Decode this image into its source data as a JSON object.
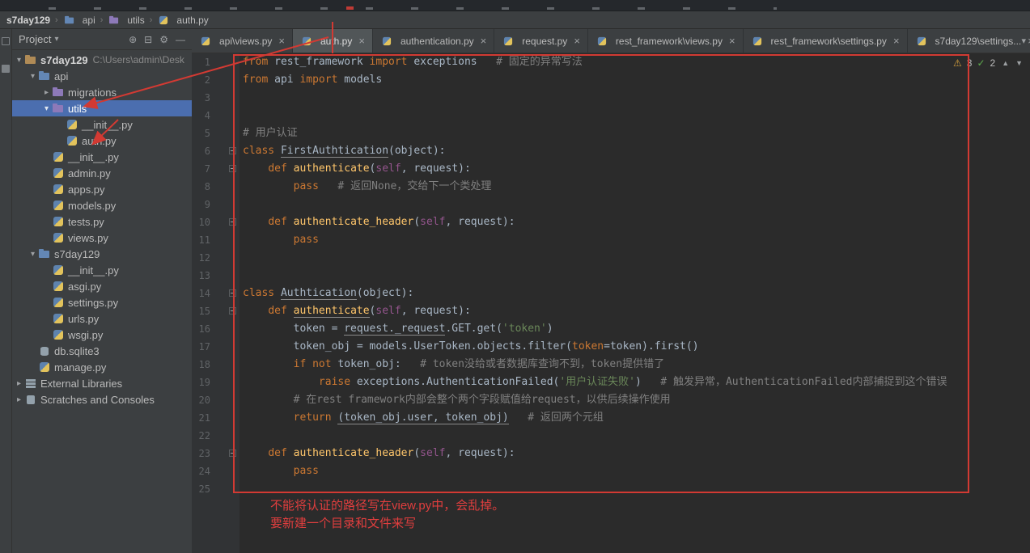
{
  "theme": {
    "editor_bg": "#2b2b2b",
    "panel_bg": "#3c3f41",
    "selection_blue": "#4b6eaf",
    "keyword_orange": "#cc7832",
    "string_green": "#6a8759",
    "comment_gray": "#808080",
    "function_yellow": "#ffc66b",
    "annotation_red": "#e03e3e",
    "warning_yellow": "#d6a13d",
    "ok_green": "#5fad4e"
  },
  "breadcrumbs": {
    "items": [
      {
        "label": "s7day129"
      },
      {
        "label": "api",
        "icon": "folder f-blue"
      },
      {
        "label": "utils",
        "icon": "folder f-purple"
      },
      {
        "label": "auth.py",
        "icon": "py"
      }
    ]
  },
  "project": {
    "header_label": "Project",
    "header_icons": {
      "locate": "⊕",
      "collapse_all": "⊟",
      "settings": "⚙",
      "hide": "—"
    },
    "items": [
      {
        "label": "s7day129",
        "sub": "C:\\Users\\admin\\Desk",
        "icon": "folder f-root",
        "indent": 1,
        "chev": "down",
        "bold": true
      },
      {
        "label": "api",
        "icon": "folder f-blue",
        "indent": 2,
        "chev": "down"
      },
      {
        "label": "migrations",
        "icon": "folder f-purple",
        "indent": 3,
        "chev": "right"
      },
      {
        "label": "utils",
        "icon": "folder f-purple",
        "indent": 3,
        "chev": "down",
        "selected": true
      },
      {
        "label": "__init__.py",
        "icon": "py",
        "indent": 4
      },
      {
        "label": "auth.py",
        "icon": "py",
        "indent": 4
      },
      {
        "label": "__init__.py",
        "icon": "py",
        "indent": 3
      },
      {
        "label": "admin.py",
        "icon": "py",
        "indent": 3
      },
      {
        "label": "apps.py",
        "icon": "py",
        "indent": 3
      },
      {
        "label": "models.py",
        "icon": "py",
        "indent": 3
      },
      {
        "label": "tests.py",
        "icon": "py",
        "indent": 3
      },
      {
        "label": "views.py",
        "icon": "py",
        "indent": 3
      },
      {
        "label": "s7day129",
        "icon": "folder f-blue",
        "indent": 2,
        "chev": "down"
      },
      {
        "label": "__init__.py",
        "icon": "py",
        "indent": 3
      },
      {
        "label": "asgi.py",
        "icon": "py",
        "indent": 3
      },
      {
        "label": "settings.py",
        "icon": "py",
        "indent": 3
      },
      {
        "label": "urls.py",
        "icon": "py",
        "indent": 3
      },
      {
        "label": "wsgi.py",
        "icon": "py",
        "indent": 3
      },
      {
        "label": "db.sqlite3",
        "icon": "db",
        "indent": 2
      },
      {
        "label": "manage.py",
        "icon": "py",
        "indent": 2
      },
      {
        "label": "External Libraries",
        "icon": "libs",
        "indent": 1,
        "chev": "right"
      },
      {
        "label": "Scratches and Consoles",
        "icon": "scratch",
        "indent": 1,
        "chev": "right"
      }
    ]
  },
  "tabs": {
    "items": [
      {
        "label": "api\\views.py"
      },
      {
        "label": "auth.py",
        "active": true
      },
      {
        "label": "authentication.py"
      },
      {
        "label": "request.py"
      },
      {
        "label": "rest_framework\\views.py"
      },
      {
        "label": "rest_framework\\settings.py"
      },
      {
        "label": "s7day129\\settings..."
      }
    ]
  },
  "inspection": {
    "warnings": "3",
    "ok": "2"
  },
  "editor": {
    "folds": [
      6,
      7,
      10,
      14,
      15,
      23
    ],
    "lines": [
      {
        "n": 1,
        "s": [
          [
            "kw",
            "from"
          ],
          [
            "",
            " rest_framework "
          ],
          [
            "kw",
            "import"
          ],
          [
            "",
            " exceptions"
          ],
          [
            "cm",
            "   # 固定的异常写法"
          ]
        ]
      },
      {
        "n": 2,
        "s": [
          [
            "kw",
            "from"
          ],
          [
            "",
            " api "
          ],
          [
            "kw",
            "import"
          ],
          [
            "",
            " models"
          ]
        ]
      },
      {
        "n": 3,
        "s": []
      },
      {
        "n": 4,
        "s": []
      },
      {
        "n": 5,
        "s": [
          [
            "cm",
            "# 用户认证"
          ]
        ]
      },
      {
        "n": 6,
        "s": [
          [
            "kw",
            "class"
          ],
          [
            "",
            " "
          ],
          [
            "u",
            "FirstAuthtication"
          ],
          [
            "",
            "(object):"
          ]
        ]
      },
      {
        "n": 7,
        "s": [
          [
            "",
            "    "
          ],
          [
            "kw",
            "def"
          ],
          [
            "",
            " "
          ],
          [
            "fn",
            "authenticate"
          ],
          [
            "",
            "("
          ],
          [
            "slf",
            "self"
          ],
          [
            "",
            ", request):"
          ]
        ]
      },
      {
        "n": 8,
        "s": [
          [
            "",
            "        "
          ],
          [
            "kw",
            "pass"
          ],
          [
            "cm",
            "   # 返回None，交给下一个类处理"
          ]
        ]
      },
      {
        "n": 9,
        "s": []
      },
      {
        "n": 10,
        "s": [
          [
            "",
            "    "
          ],
          [
            "kw",
            "def"
          ],
          [
            "",
            " "
          ],
          [
            "fn",
            "authenticate_header"
          ],
          [
            "",
            "("
          ],
          [
            "slf",
            "self"
          ],
          [
            "",
            ", request):"
          ]
        ]
      },
      {
        "n": 11,
        "s": [
          [
            "",
            "        "
          ],
          [
            "kw",
            "pass"
          ]
        ]
      },
      {
        "n": 12,
        "s": []
      },
      {
        "n": 13,
        "s": []
      },
      {
        "n": 14,
        "s": [
          [
            "kw",
            "class"
          ],
          [
            "",
            " "
          ],
          [
            "u",
            "Authtication"
          ],
          [
            "",
            "(object):"
          ]
        ]
      },
      {
        "n": 15,
        "s": [
          [
            "",
            "    "
          ],
          [
            "kw",
            "def"
          ],
          [
            "",
            " "
          ],
          [
            "fn u",
            "authenticate"
          ],
          [
            "",
            "("
          ],
          [
            "slf",
            "self"
          ],
          [
            "",
            ", request):"
          ]
        ]
      },
      {
        "n": 16,
        "s": [
          [
            "",
            "        token = "
          ],
          [
            "u",
            "request._request"
          ],
          [
            "",
            ".GET.get("
          ],
          [
            "str",
            "'token'"
          ],
          [
            "",
            ")"
          ]
        ]
      },
      {
        "n": 17,
        "s": [
          [
            "",
            "        token_obj = models.UserToken.objects.filter("
          ],
          [
            "kw",
            "token"
          ],
          [
            "",
            "=token).first()"
          ]
        ]
      },
      {
        "n": 18,
        "s": [
          [
            "",
            "        "
          ],
          [
            "kw",
            "if"
          ],
          [
            "",
            " "
          ],
          [
            "kw",
            "not"
          ],
          [
            "",
            " token_obj:"
          ],
          [
            "cm",
            "   # token没给或者数据库查询不到，token提供错了"
          ]
        ]
      },
      {
        "n": 19,
        "s": [
          [
            "",
            "            "
          ],
          [
            "kw",
            "raise"
          ],
          [
            "",
            " exceptions.AuthenticationFailed("
          ],
          [
            "str",
            "'用户认证失败'"
          ],
          [
            "",
            ")"
          ],
          [
            "cm",
            "   # 触发异常，AuthenticationFailed内部捕捉到这个错误"
          ]
        ]
      },
      {
        "n": 20,
        "s": [
          [
            "",
            "        "
          ],
          [
            "cm",
            "# 在rest framework内部会整个两个字段赋值给request，以供后续操作使用"
          ]
        ]
      },
      {
        "n": 21,
        "s": [
          [
            "",
            "        "
          ],
          [
            "kw",
            "return"
          ],
          [
            "",
            " "
          ],
          [
            "u",
            "(token_obj.user, token_obj)"
          ],
          [
            "cm",
            "   # 返回两个元组"
          ]
        ]
      },
      {
        "n": 22,
        "s": []
      },
      {
        "n": 23,
        "s": [
          [
            "",
            "    "
          ],
          [
            "kw",
            "def"
          ],
          [
            "",
            " "
          ],
          [
            "fn",
            "authenticate_header"
          ],
          [
            "",
            "("
          ],
          [
            "slf",
            "self"
          ],
          [
            "",
            ", request):"
          ]
        ]
      },
      {
        "n": 24,
        "s": [
          [
            "",
            "        "
          ],
          [
            "kw",
            "pass"
          ]
        ]
      },
      {
        "n": 25,
        "s": []
      }
    ]
  },
  "annotations": {
    "note1": "不能将认证的路径写在view.py中，会乱掉。",
    "note2": "要新建一个目录和文件来写"
  }
}
